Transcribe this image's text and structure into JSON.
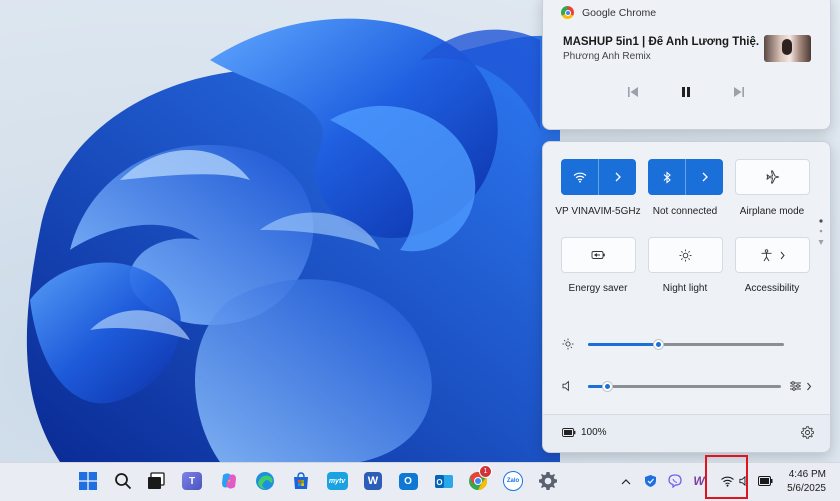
{
  "media": {
    "source_app": "Google Chrome",
    "title": "MASHUP 5in1 |  Để Anh Lương Thiệ...",
    "artist": "Phương Anh Remix",
    "icons": [
      "chrome-icon",
      "previous-track-icon",
      "pause-icon",
      "next-track-icon"
    ]
  },
  "quick_settings": {
    "wifi": {
      "label": "VP VINAVIM-5GHz",
      "state": "on"
    },
    "bluetooth": {
      "label": "Not connected",
      "state": "on"
    },
    "airplane": {
      "label": "Airplane mode",
      "state": "off"
    },
    "energy_saver": {
      "label": "Energy saver"
    },
    "night_light": {
      "label": "Night light"
    },
    "accessibility": {
      "label": "Accessibility"
    },
    "brightness_level": 0.36,
    "volume_level": 0.1,
    "battery": "100%",
    "accent_color": "#1a6fd8"
  },
  "taskbar": {
    "apps": [
      "windows-start",
      "search",
      "task-view",
      "teams",
      "copilot",
      "edge",
      "microsoft-store",
      "mytv",
      "word",
      "outlook",
      "chrome",
      "zalo",
      "settings"
    ],
    "chrome_badge": "1",
    "mytv_label": "mytv",
    "word_label": "W",
    "outlook_label": "O",
    "zalo_label": "Zalo",
    "tray": [
      "chevron-up",
      "defender",
      "viber",
      "winrar",
      "wifi",
      "volume",
      "battery"
    ],
    "winrar_label": "W"
  },
  "clock": {
    "time": "4:46 PM",
    "date": "5/6/2025"
  }
}
